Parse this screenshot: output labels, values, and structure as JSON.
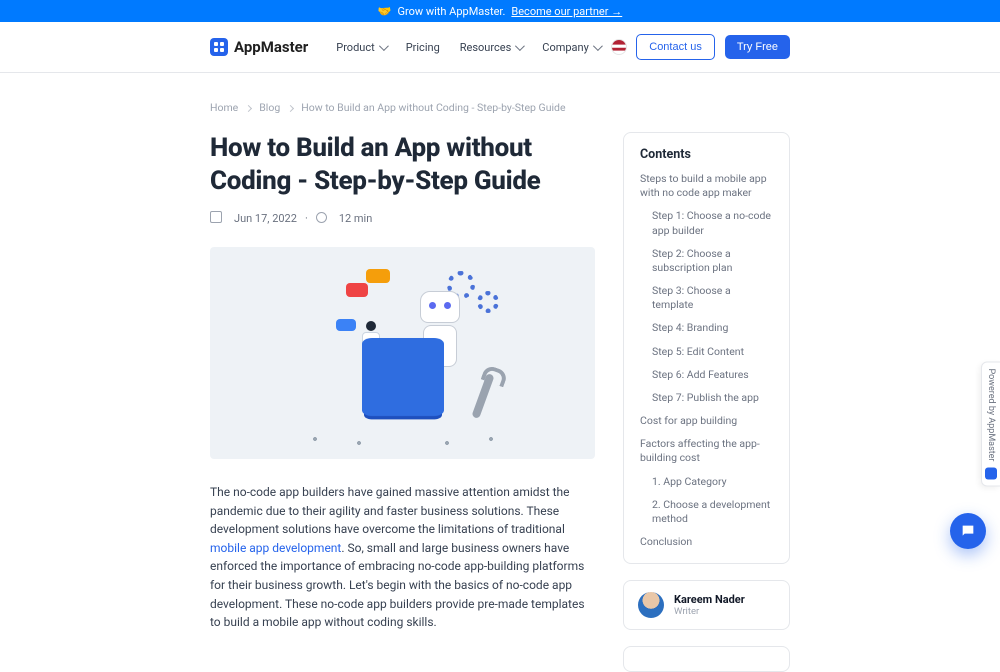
{
  "announce": {
    "emoji": "🤝",
    "text": "Grow with AppMaster.",
    "cta": "Become our partner"
  },
  "brand": {
    "name": "AppMaster"
  },
  "nav": {
    "items": [
      "Product",
      "Pricing",
      "Resources",
      "Company"
    ]
  },
  "header_actions": {
    "contact": "Contact us",
    "try": "Try Free"
  },
  "breadcrumbs": {
    "home": "Home",
    "section": "Blog",
    "current": "How to Build an App without Coding - Step-by-Step Guide"
  },
  "article": {
    "title": "How to Build an App without Coding - Step-by-Step Guide",
    "date": "Jun 17, 2022",
    "read_time": "12 min",
    "intro_before_link": "The no-code app builders have gained massive attention amidst the pandemic due to their agility and faster business solutions. These development solutions have overcome the limitations of traditional ",
    "intro_link": "mobile app development",
    "intro_after_link": ". So, small and large business owners have enforced the importance of embracing no-code app-building platforms for their business growth. Let's begin with the basics of no-code app development. These no-code app builders provide pre-made templates to build a mobile app without coding skills."
  },
  "toc": {
    "heading": "Contents",
    "items": [
      {
        "label": "Steps to build a mobile app with no code app maker",
        "sub": false
      },
      {
        "label": "Step 1: Choose a no-code app builder",
        "sub": true
      },
      {
        "label": "Step 2: Choose a subscription plan",
        "sub": true
      },
      {
        "label": "Step 3: Choose a template",
        "sub": true
      },
      {
        "label": "Step 4: Branding",
        "sub": true
      },
      {
        "label": "Step 5: Edit Content",
        "sub": true
      },
      {
        "label": "Step 6: Add Features",
        "sub": true
      },
      {
        "label": "Step 7: Publish the app",
        "sub": true
      },
      {
        "label": "Cost for app building",
        "sub": false
      },
      {
        "label": "Factors affecting the app-building cost",
        "sub": false
      },
      {
        "label": "1. App Category",
        "sub": true
      },
      {
        "label": "2. Choose a development method",
        "sub": true
      },
      {
        "label": "Conclusion",
        "sub": false
      }
    ]
  },
  "author": {
    "name": "Kareem Nader",
    "role": "Writer"
  },
  "powered": "Powered by AppMaster"
}
